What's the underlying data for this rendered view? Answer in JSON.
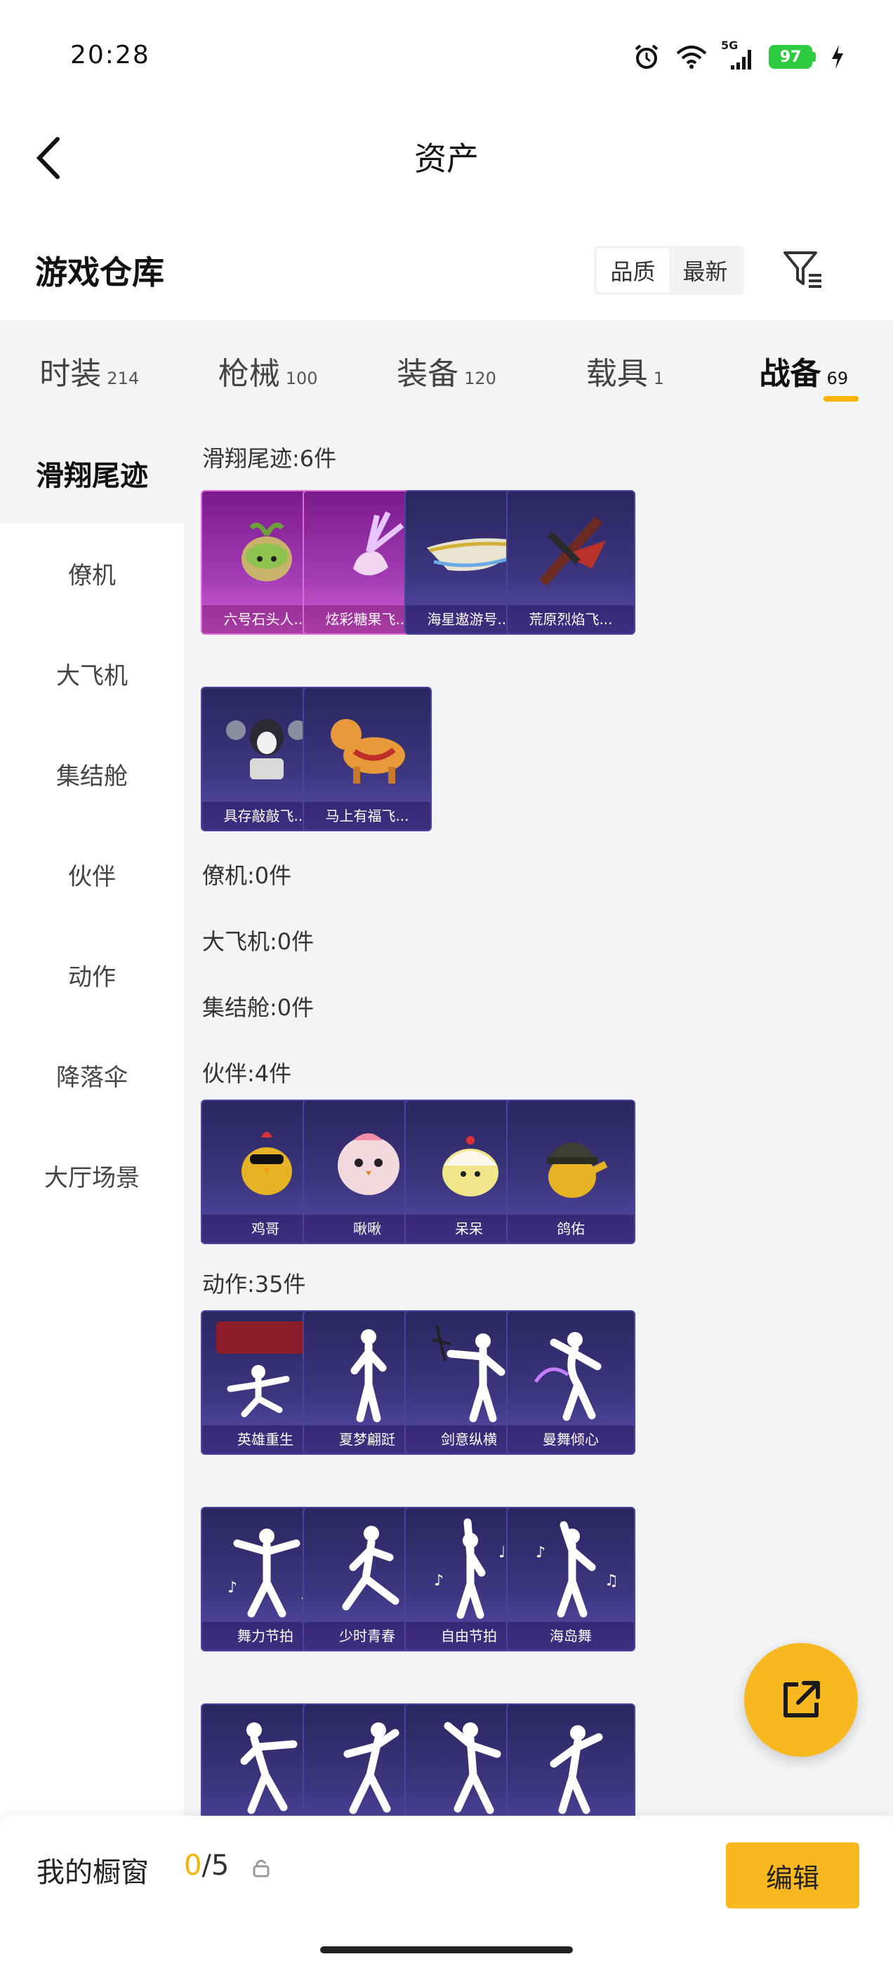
{
  "status": {
    "time": "20:28",
    "network": "5G",
    "battery": "97"
  },
  "header": {
    "title": "资产"
  },
  "repo": {
    "title": "游戏仓库",
    "sort_options": [
      "品质",
      "最新"
    ],
    "active_sort": "品质"
  },
  "tabs": [
    {
      "label": "时装",
      "count": "214"
    },
    {
      "label": "枪械",
      "count": "100"
    },
    {
      "label": "装备",
      "count": "120"
    },
    {
      "label": "载具",
      "count": "1"
    },
    {
      "label": "战备",
      "count": "69"
    }
  ],
  "active_tab": "战备",
  "sidebar": {
    "items": [
      "滑翔尾迹",
      "僚机",
      "大飞机",
      "集结舱",
      "伙伴",
      "动作",
      "降落伞",
      "大厅场景"
    ],
    "active": "滑翔尾迹"
  },
  "sections": [
    {
      "title": "滑翔尾迹:6件",
      "items": [
        "六号石头人...",
        "炫彩糖果飞...",
        "海星遨游号...",
        "荒原烈焰飞...",
        "具存敲敲飞...",
        "马上有福飞..."
      ],
      "styles": [
        "pink",
        "pink",
        "blue",
        "blue",
        "blue",
        "blue"
      ]
    },
    {
      "title": "僚机:0件",
      "items": []
    },
    {
      "title": "大飞机:0件",
      "items": []
    },
    {
      "title": "集结舱:0件",
      "items": []
    },
    {
      "title": "伙伴:4件",
      "items": [
        "鸡哥",
        "啾啾",
        "呆呆",
        "鸽佑"
      ]
    },
    {
      "title": "动作:35件",
      "items": [
        "英雄重生",
        "夏梦翩跹",
        "剑意纵横",
        "曼舞倾心",
        "舞力节拍",
        "少时青春",
        "自由节拍",
        "海岛舞",
        "",
        "",
        "",
        ""
      ]
    }
  ],
  "bottom": {
    "showcase_label": "我的橱窗",
    "showcase_current": "0",
    "showcase_total": "/5",
    "edit_label": "编辑"
  },
  "colors": {
    "accent": "#f8b81f",
    "tab_indicator": "#f5b400",
    "card_blue": "#3d3680",
    "card_pink": "#a33bb5"
  }
}
